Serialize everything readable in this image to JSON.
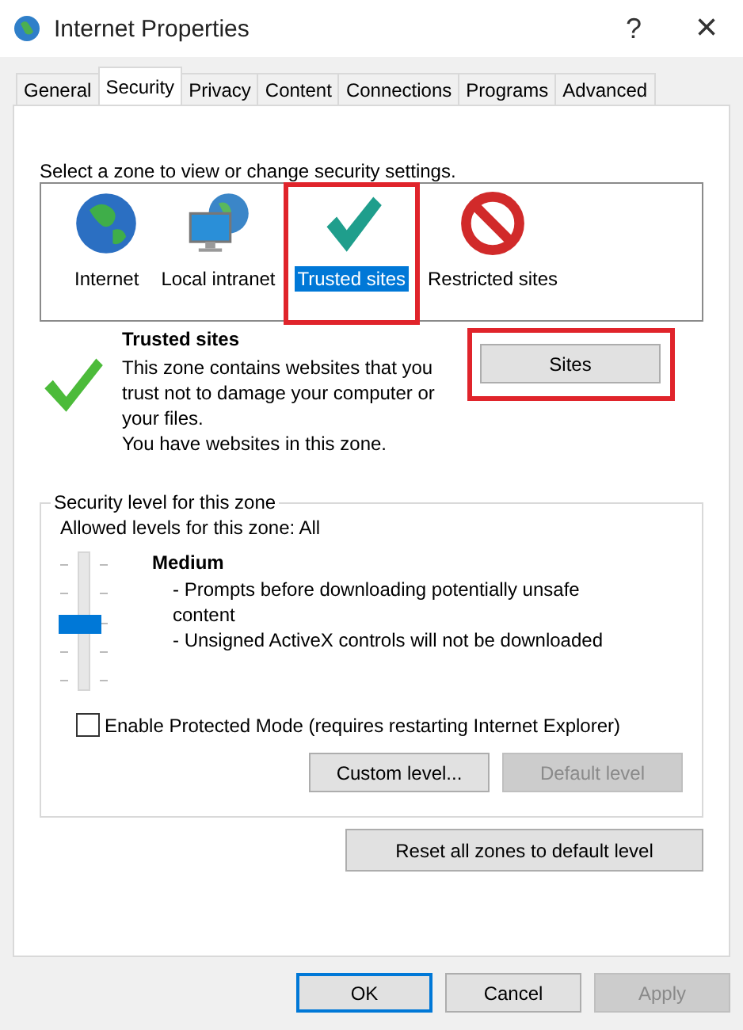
{
  "window": {
    "title": "Internet Properties",
    "help": "?",
    "close": "×"
  },
  "tabs": [
    {
      "label": "General",
      "selected": false
    },
    {
      "label": "Security",
      "selected": true
    },
    {
      "label": "Privacy",
      "selected": false
    },
    {
      "label": "Content",
      "selected": false
    },
    {
      "label": "Connections",
      "selected": false
    },
    {
      "label": "Programs",
      "selected": false
    },
    {
      "label": "Advanced",
      "selected": false
    }
  ],
  "zone_prompt": "Select a zone to view or change security settings.",
  "zones": [
    {
      "kind": "globe",
      "label": "Internet",
      "selected": false,
      "highlighted": false
    },
    {
      "kind": "intranet",
      "label": "Local intranet",
      "selected": false,
      "highlighted": false
    },
    {
      "kind": "trusted",
      "label": "Trusted sites",
      "selected": true,
      "highlighted": true
    },
    {
      "kind": "restricted",
      "label": "Restricted sites",
      "selected": false,
      "highlighted": false
    }
  ],
  "zone_info": {
    "title": "Trusted sites",
    "lines": [
      "This zone contains websites that you trust not to damage your computer or your files.",
      "You have websites in this zone."
    ],
    "sites_button": {
      "label": "Sites",
      "highlighted": true
    }
  },
  "security_level": {
    "legend": "Security level for this zone",
    "allowed": "Allowed levels for this zone: All",
    "level": 0.5,
    "name": "Medium",
    "bullets": [
      "- Prompts before downloading potentially unsafe content",
      "- Unsigned ActiveX controls will not be downloaded"
    ],
    "protected_mode": {
      "label": "Enable Protected Mode (requires restarting Internet Explorer)",
      "checked": false
    },
    "buttons": [
      {
        "label": "Custom level...",
        "disabled": false
      },
      {
        "label": "Default level",
        "disabled": true
      }
    ]
  },
  "reset_button": {
    "label": "Reset all zones to default level",
    "disabled": false
  },
  "footer_buttons": [
    {
      "label": "OK",
      "disabled": false,
      "default": true
    },
    {
      "label": "Cancel",
      "disabled": false,
      "default": false
    },
    {
      "label": "Apply",
      "disabled": true,
      "default": false
    }
  ]
}
